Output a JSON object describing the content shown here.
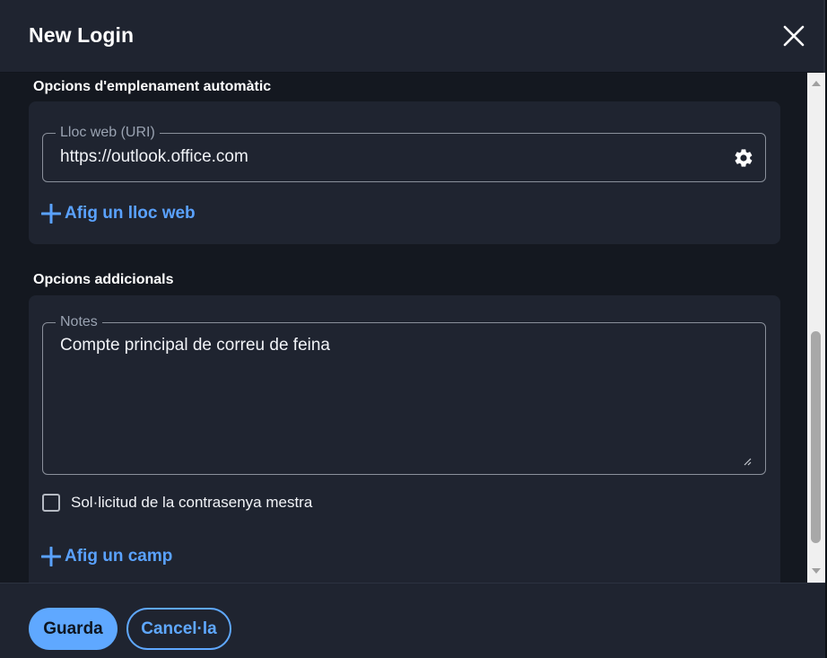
{
  "dialog": {
    "title": "New Login"
  },
  "autofill": {
    "section_title": "Opcions d'emplenament automàtic",
    "uri_label": "Lloc web (URI)",
    "uri_value": "https://outlook.office.com",
    "add_website": "Afig un lloc web"
  },
  "additional": {
    "section_title": "Opcions addicionals",
    "notes_label": "Notes",
    "notes_value": "Compte principal de correu de feina",
    "master_password_reprompt": "Sol·licitud de la contrasenya mestra",
    "master_password_reprompt_checked": false,
    "add_field": "Afig un camp"
  },
  "footer": {
    "save": "Guarda",
    "cancel": "Cancel·la"
  },
  "icons": {
    "close": "close-icon",
    "settings": "gear-icon",
    "add": "plus-icon",
    "resize": "resize-grip-icon",
    "scroll_up": "chevron-up-icon",
    "scroll_down": "chevron-down-icon"
  },
  "colors": {
    "accent": "#5fa8ff",
    "surface": "#1f2430",
    "background": "#141820"
  }
}
